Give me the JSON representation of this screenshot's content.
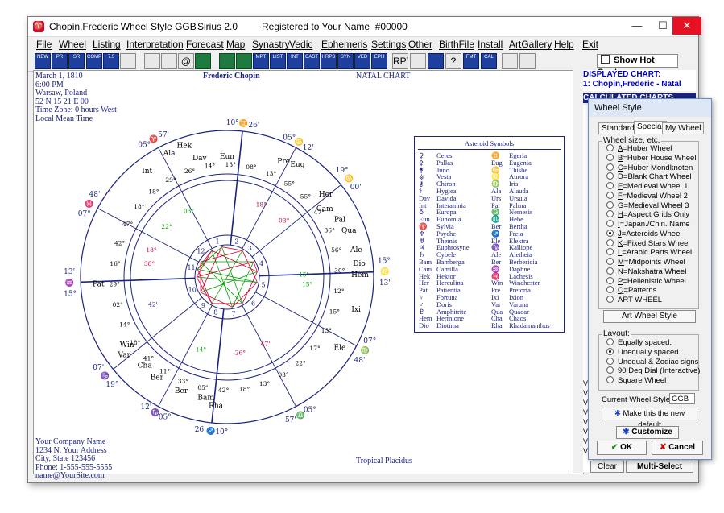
{
  "window": {
    "title": "Chopin,Frederic Wheel Style GGB",
    "app": "Sirius 2.0",
    "registration": "Registered to Your Name  #00000"
  },
  "menu": [
    "File",
    "Wheel",
    "Listing",
    "Interpretation",
    "Forecast",
    "Map",
    "Synastry",
    "Vedic",
    "Ephemeris",
    "Settings",
    "Other",
    "BirthFile",
    "Install",
    "ArtGallery",
    "Help",
    "Exit"
  ],
  "toolbar": {
    "buttons": [
      "NEW",
      "PR",
      "SR",
      "COMP",
      "7.5",
      "",
      "",
      "",
      "@",
      "",
      "",
      "",
      "MPT",
      "LIST",
      "INT",
      "CAST",
      "HRPS",
      "SYN",
      "VED",
      "EPH",
      "RPT",
      "",
      "",
      "?",
      "FMT",
      "CAL",
      "",
      ""
    ],
    "hot_spots_label": "Show Hot Spots"
  },
  "chart": {
    "info_lines": [
      "March 1, 1810",
      "6:00 PM",
      "Warsaw, Poland",
      "52 N 15    21 E 00",
      "Time Zone: 0 hours West",
      "Local Mean Time"
    ],
    "name": "Frederic Chopin",
    "type": "NATAL CHART",
    "footer": [
      "Your Company Name",
      "1234 N. Your Address",
      "City, State 123456",
      "Phone: 1-555-555-5555",
      "name@YourSite.com"
    ],
    "system": "Tropical Placidus",
    "cusps": [
      {
        "deg": "10°",
        "sign": "♊",
        "min": "26'"
      },
      {
        "deg": "05°",
        "sign": "♋",
        "min": "12'"
      },
      {
        "deg": "19°",
        "sign": "♋",
        "min": "00'"
      },
      {
        "deg": "15°",
        "sign": "♌",
        "min": "13'"
      },
      {
        "deg": "07°",
        "sign": "♍",
        "min": "48'"
      },
      {
        "deg": "05°",
        "sign": "♎",
        "min": "57'"
      },
      {
        "deg": "10°",
        "sign": "♐",
        "min": "26'"
      },
      {
        "deg": "05°",
        "sign": "♑",
        "min": "12'"
      },
      {
        "deg": "19°",
        "sign": "♑",
        "min": "07'"
      },
      {
        "deg": "15°",
        "sign": "♒",
        "min": "13'"
      },
      {
        "deg": "07°",
        "sign": "♓",
        "min": "48'"
      },
      {
        "deg": "05°",
        "sign": "♈",
        "min": "57'"
      }
    ],
    "planets_outer": [
      {
        "label": "Dav",
        "a": 103,
        "r": 152
      },
      {
        "label": "Eun",
        "a": 90,
        "r": 150
      },
      {
        "label": "Ala",
        "a": 115,
        "r": 170
      },
      {
        "label": "Hek",
        "a": 108,
        "r": 172
      },
      {
        "label": "Int",
        "a": 127,
        "r": 165
      },
      {
        "label": "Pre",
        "a": 64,
        "r": 160
      },
      {
        "label": "Eug",
        "a": 58,
        "r": 165
      },
      {
        "label": "Her",
        "a": 40,
        "r": 160
      },
      {
        "label": "Cam",
        "a": 35,
        "r": 148
      },
      {
        "label": "Pal",
        "a": 27,
        "r": 157
      },
      {
        "label": "Qua",
        "a": 21,
        "r": 162
      },
      {
        "label": "Ale",
        "a": 12,
        "r": 164
      },
      {
        "label": "Dio",
        "a": 6,
        "r": 165
      },
      {
        "label": "Hem",
        "a": 1,
        "r": 165
      },
      {
        "label": "Ixi",
        "a": -14,
        "r": 165
      },
      {
        "label": "Ele",
        "a": -32,
        "r": 165
      },
      {
        "label": "Pat",
        "a": 183,
        "r": 160
      },
      {
        "label": "Var",
        "a": -143,
        "r": 160
      },
      {
        "label": "Win",
        "a": -146,
        "r": 150
      },
      {
        "label": "Cha",
        "a": -133,
        "r": 150
      },
      {
        "label": "Ber",
        "a": -125,
        "r": 152
      },
      {
        "label": "Ber",
        "a": -112,
        "r": 152
      },
      {
        "label": "Bam",
        "a": -100,
        "r": 152
      },
      {
        "label": "Rha",
        "a": -95,
        "r": 160
      }
    ],
    "degree_labels": [
      "29°",
      "26°",
      "14°",
      "13°",
      "08°",
      "13°",
      "55°",
      "55°",
      "47°",
      "36°",
      "56°",
      "30°",
      "12°",
      "15°",
      "13°",
      "17°",
      "22°",
      "03°",
      "13°",
      "18°",
      "42°",
      "05°",
      "33°",
      "11°",
      "41°",
      "18°",
      "14°",
      "02°",
      "29°",
      "16°",
      "42°",
      "47°",
      "18°",
      "18°"
    ],
    "inner_signs_colors": {
      "red": "#cc0033",
      "green": "#00a000",
      "blue": "#1a237e"
    },
    "inner_planets": [
      {
        "label": "03°",
        "a": 120,
        "r": 95,
        "c": "green"
      },
      {
        "label": "22°",
        "a": 140,
        "r": 98,
        "c": "green"
      },
      {
        "label": "18°",
        "a": 160,
        "r": 100,
        "c": "red"
      },
      {
        "label": "38°",
        "a": 170,
        "r": 98,
        "c": "red"
      },
      {
        "label": "18°",
        "a": 65,
        "r": 100,
        "c": "red"
      },
      {
        "label": "03°",
        "a": 45,
        "r": 100,
        "c": "red"
      },
      {
        "label": "15'",
        "a": 2,
        "r": 95,
        "c": "green"
      },
      {
        "label": "15°",
        "a": -5,
        "r": 100,
        "c": "green"
      },
      {
        "label": "14°",
        "a": -110,
        "r": 95,
        "c": "green"
      },
      {
        "label": "26°",
        "a": -80,
        "r": 95,
        "c": "red"
      },
      {
        "label": "47'",
        "a": -60,
        "r": 95,
        "c": "red"
      },
      {
        "label": "42'",
        "a": -160,
        "r": 98,
        "c": "blue"
      }
    ],
    "house_numbers": [
      "1",
      "2",
      "3",
      "4",
      "5",
      "6",
      "7",
      "8",
      "9",
      "10",
      "11",
      "12"
    ]
  },
  "asteroid_symbols": {
    "title": "Asteroid Symbols",
    "left": [
      [
        "⚳",
        "Ceres"
      ],
      [
        "⚴",
        "Pallas"
      ],
      [
        "⚵",
        "Juno"
      ],
      [
        "⚶",
        "Vesta"
      ],
      [
        "⚷",
        "Chiron"
      ],
      [
        "⚕",
        "Hygiea"
      ],
      [
        "Dav",
        "Davida"
      ],
      [
        "Int",
        "Interamnia"
      ],
      [
        "♁",
        "Europa"
      ],
      [
        "Eun",
        "Eunomia"
      ],
      [
        "♈",
        "Sylvia"
      ],
      [
        "♆",
        "Psyche"
      ],
      [
        "♅",
        "Themis"
      ],
      [
        "♃",
        "Euphrosyne"
      ],
      [
        "♄",
        "Cybele"
      ],
      [
        "Bam",
        "Bamberga"
      ],
      [
        "Cam",
        "Camilla"
      ],
      [
        "Hek",
        "Hektor"
      ],
      [
        "Her",
        "Herculina"
      ],
      [
        "Pat",
        "Patientia"
      ],
      [
        "♀",
        "Fortuna"
      ],
      [
        "♂",
        "Doris"
      ],
      [
        "♇",
        "Amphitrite"
      ],
      [
        "Hem",
        "Hermione"
      ],
      [
        "Dio",
        "Diotima"
      ]
    ],
    "right": [
      [
        "♊",
        "Egeria"
      ],
      [
        "Eug",
        "Eugenia"
      ],
      [
        "♋",
        "Thisbe"
      ],
      [
        "♌",
        "Aurora"
      ],
      [
        "♍",
        "Iris"
      ],
      [
        "Ala",
        "Alauda"
      ],
      [
        "Urs",
        "Ursula"
      ],
      [
        "Pal",
        "Palma"
      ],
      [
        "♎",
        "Nemesis"
      ],
      [
        "♏",
        "Hebe"
      ],
      [
        "Ber",
        "Bertha"
      ],
      [
        "♐",
        "Freia"
      ],
      [
        "Ele",
        "Elektra"
      ],
      [
        "♑",
        "Kalliope"
      ],
      [
        "Ale",
        "Aletheia"
      ],
      [
        "Ber",
        "Berbericia"
      ],
      [
        "♒",
        "Daphne"
      ],
      [
        "♓",
        "Lachesis"
      ],
      [
        "Win",
        "Winchester"
      ],
      [
        "Pre",
        "Pretoria"
      ],
      [
        "Ixi",
        "Ixion"
      ],
      [
        "Var",
        "Varuna"
      ],
      [
        "Qua",
        "Quaoar"
      ],
      [
        "Cha",
        "Chaos"
      ],
      [
        "Rha",
        "Rhadamanthus"
      ]
    ]
  },
  "right_panel": {
    "displayed_chart": "DISPLAYED CHART:",
    "chart_entry": "1: Chopin,Frederic - Natal",
    "calculated_charts": "CALCULATED CHARTS",
    "clear": "Clear",
    "multi_select": "Multi-Select"
  },
  "wheel_style": {
    "title": "Wheel Style",
    "tabs": [
      "Standard",
      "Special",
      "My Wheel"
    ],
    "size_group": "Wheel size, etc.",
    "options": [
      {
        "key": "A",
        "label": "Huber Wheel",
        "selected": false
      },
      {
        "key": "B",
        "label": "Huber House Wheel",
        "selected": false
      },
      {
        "key": "C",
        "label": "Huber Mondknoten",
        "selected": false
      },
      {
        "key": "D",
        "label": "Blank Chart Wheel",
        "selected": false
      },
      {
        "key": "E",
        "label": "Medieval Wheel 1",
        "selected": false
      },
      {
        "key": "F",
        "label": "Medieval Wheel 2",
        "selected": false
      },
      {
        "key": "G",
        "label": "Medieval Wheel 3",
        "selected": false
      },
      {
        "key": "H",
        "label": "Aspect Grids Only",
        "selected": false
      },
      {
        "key": "I",
        "label": "Japan./Chin. Name",
        "selected": false
      },
      {
        "key": "J",
        "label": "Asteroids Wheel",
        "selected": true
      },
      {
        "key": "K",
        "label": "Fixed Stars Wheel",
        "selected": false
      },
      {
        "key": "L",
        "label": "Arabic Parts Wheel",
        "selected": false
      },
      {
        "key": "M",
        "label": "Midpoints Wheel",
        "selected": false
      },
      {
        "key": "N",
        "label": "Nakshatra Wheel",
        "selected": false
      },
      {
        "key": "P",
        "label": "Hellenistic Wheel",
        "selected": false
      },
      {
        "key": "Q",
        "label": "Patterns",
        "selected": false
      },
      {
        "key": "",
        "label": "ART WHEEL",
        "selected": false
      }
    ],
    "art_wheel_button": "Art Wheel Style",
    "layout_group": "Layout:",
    "layouts": [
      {
        "label": "Equally spaced.",
        "selected": false
      },
      {
        "label": "Unequally spaced.",
        "selected": true
      },
      {
        "label": "Unequal & Zodiac signs",
        "selected": false
      },
      {
        "label": "90 Deg Dial (Interactive)",
        "selected": false
      },
      {
        "label": "Square Wheel",
        "selected": false
      }
    ],
    "current_label": "Current Wheel Style:",
    "current_value": "GGB",
    "make_default": "Make this the new default",
    "customize": "Customize",
    "ok": "OK",
    "cancel": "Cancel"
  }
}
